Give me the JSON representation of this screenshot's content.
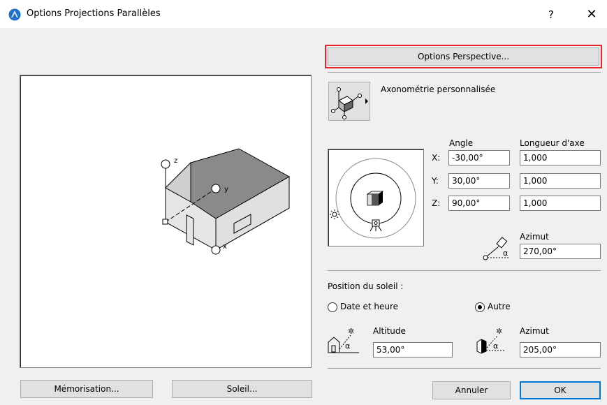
{
  "dialog": {
    "title": "Options Projections Parallèles",
    "help_glyph": "?",
    "close_glyph": "✕"
  },
  "buttons": {
    "perspective": "Options Perspective...",
    "memorisation": "Mémorisation...",
    "soleil": "Soleil...",
    "annuler": "Annuler",
    "ok": "OK"
  },
  "projection": {
    "type_label": "Axonométrie personnalisée"
  },
  "preview_axes": {
    "z": "z",
    "y": "y",
    "x": "x"
  },
  "axes_table": {
    "angle_header": "Angle",
    "length_header": "Longueur d'axe",
    "rows": [
      {
        "label": "X:",
        "angle": "-30,00°",
        "length": "1,000"
      },
      {
        "label": "Y:",
        "angle": "30,00°",
        "length": "1,000"
      },
      {
        "label": "Z:",
        "angle": "90,00°",
        "length": "1,000"
      }
    ]
  },
  "camera_azimuth": {
    "label": "Azimut",
    "value": "270,00°"
  },
  "sun": {
    "section_label": "Position du soleil :",
    "option_date": "Date et heure",
    "option_other": "Autre",
    "selected": "Autre",
    "altitude_label": "Altitude",
    "altitude_value": "53,00°",
    "azimuth_label": "Azimut",
    "azimuth_value": "205,00°"
  },
  "colors": {
    "highlight": "#e8232a",
    "default_button_border": "#0078d7",
    "roof": "#8a8a8a",
    "wall_front": "#bdbdbd",
    "wall_side": "#e6e6e6"
  }
}
